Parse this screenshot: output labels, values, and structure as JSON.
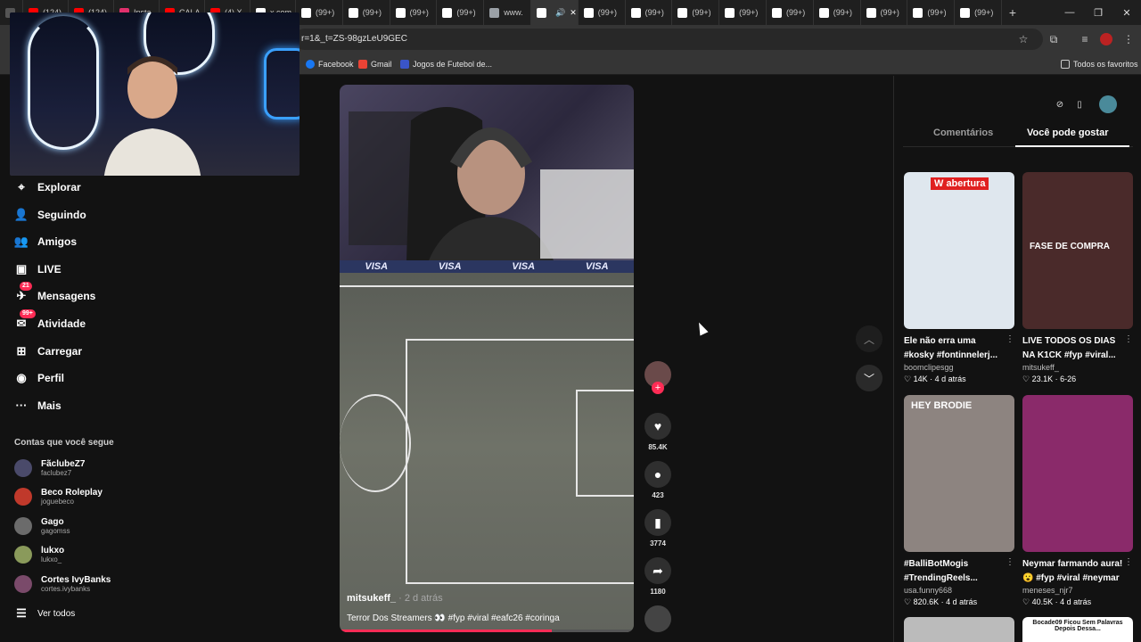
{
  "browser": {
    "tabs": [
      {
        "label": "(124)",
        "color": "#ff0000"
      },
      {
        "label": "(124)",
        "color": "#ff0000"
      },
      {
        "label": "Insta",
        "color": "#e1306c"
      },
      {
        "label": "CALA",
        "color": "#ff0000"
      },
      {
        "label": "(4) X",
        "color": "#ff0000"
      },
      {
        "label": "x.com",
        "color": "#ffffff"
      },
      {
        "label": "(99+)",
        "color": "#ffffff"
      },
      {
        "label": "(99+)",
        "color": "#ffffff"
      },
      {
        "label": "(99+)",
        "color": "#ffffff"
      },
      {
        "label": "(99+)",
        "color": "#ffffff"
      },
      {
        "label": "www.",
        "color": "#9aa0a6"
      },
      {
        "label": "",
        "color": "#ffffff",
        "active": true
      },
      {
        "label": "(99+)",
        "color": "#ffffff"
      },
      {
        "label": "(99+)",
        "color": "#ffffff"
      },
      {
        "label": "(99+)",
        "color": "#ffffff"
      },
      {
        "label": "(99+)",
        "color": "#ffffff"
      },
      {
        "label": "(99+)",
        "color": "#ffffff"
      },
      {
        "label": "(99+)",
        "color": "#ffffff"
      },
      {
        "label": "(99+)",
        "color": "#ffffff"
      },
      {
        "label": "(99+)",
        "color": "#ffffff"
      },
      {
        "label": "(99+)",
        "color": "#ffffff"
      }
    ],
    "url": "r=1&_t=ZS-98gzLeU9GEC",
    "bookmarks": [
      "Facebook",
      "Gmail",
      "Jogos de Futebol de..."
    ],
    "all_bookmarks": "Todos os favoritos"
  },
  "sidebar": {
    "nav": [
      {
        "label": "Explorar",
        "icon": "compass-icon",
        "glyph": "⌖"
      },
      {
        "label": "Seguindo",
        "icon": "following-icon",
        "glyph": "👤"
      },
      {
        "label": "Amigos",
        "icon": "friends-icon",
        "glyph": "👥"
      },
      {
        "label": "LIVE",
        "icon": "live-icon",
        "glyph": "▣"
      },
      {
        "label": "Mensagens",
        "icon": "messages-icon",
        "glyph": "✈",
        "badge": "21"
      },
      {
        "label": "Atividade",
        "icon": "activity-icon",
        "glyph": "✉",
        "badge": "99+"
      },
      {
        "label": "Carregar",
        "icon": "upload-icon",
        "glyph": "⊞"
      },
      {
        "label": "Perfil",
        "icon": "profile-avatar-icon",
        "glyph": "◉"
      },
      {
        "label": "Mais",
        "icon": "more-dots-icon",
        "glyph": "···"
      }
    ],
    "following_title": "Contas que você segue",
    "following": [
      {
        "name": "FãclubeZ7",
        "handle": "faclubez7",
        "color": "#4a4a6a"
      },
      {
        "name": "Beco Roleplay",
        "handle": "joguebeco",
        "color": "#c0392b"
      },
      {
        "name": "Gago",
        "handle": "gagomss",
        "color": "#6b6b6b"
      },
      {
        "name": "lukxo",
        "handle": "lukxo_",
        "color": "#8a9a5b"
      },
      {
        "name": "Cortes IvyBanks",
        "handle": "cortes.ivybanks",
        "color": "#7a4a6a"
      }
    ],
    "see_all": "Ver todos"
  },
  "video": {
    "author": "mitsukeff_",
    "time": "· 2 d atrás",
    "caption": "Terror Dos Streamers 👀 #fyp #viral #eafc26 #coringa",
    "sponsor": "VISA",
    "progress": 0.72
  },
  "actions": {
    "likes": "85.4K",
    "comments": "423",
    "saves": "3774",
    "shares": "1180"
  },
  "right_panel": {
    "tabs": [
      "Comentários",
      "Você pode gostar"
    ],
    "active_tab": 1,
    "cards": [
      {
        "title": "Ele não erra uma #kosky #fontinnelerj...",
        "user": "boomclipesgg",
        "likes": "14K",
        "age": "4 d atrás",
        "overlay": "W abertura",
        "bg": "#dfe7ee"
      },
      {
        "title": "LIVE TODOS OS DIAS NA K1CK #fyp #viral...",
        "user": "mitsukeff_",
        "likes": "23.1K",
        "age": "6-26",
        "overlay": "FASE DE COMPRA",
        "bg": "#4a2a2a"
      },
      {
        "title": "#BalliBotMogis #TrendingReels...",
        "user": "usa.funny668",
        "likes": "820.6K",
        "age": "4 d atrás",
        "overlay": "HEY BRODIE",
        "bg": "#8d8480"
      },
      {
        "title": "Neymar farmando aura! 😮 #fyp #viral #neymar",
        "user": "meneses_njr7",
        "likes": "40.5K",
        "age": "4 d atrás",
        "overlay": "",
        "bg": "#8a2a6a"
      }
    ],
    "bottom_card_text": "Bocade09 Ficou Sem Palavras Depois Dessa..."
  }
}
